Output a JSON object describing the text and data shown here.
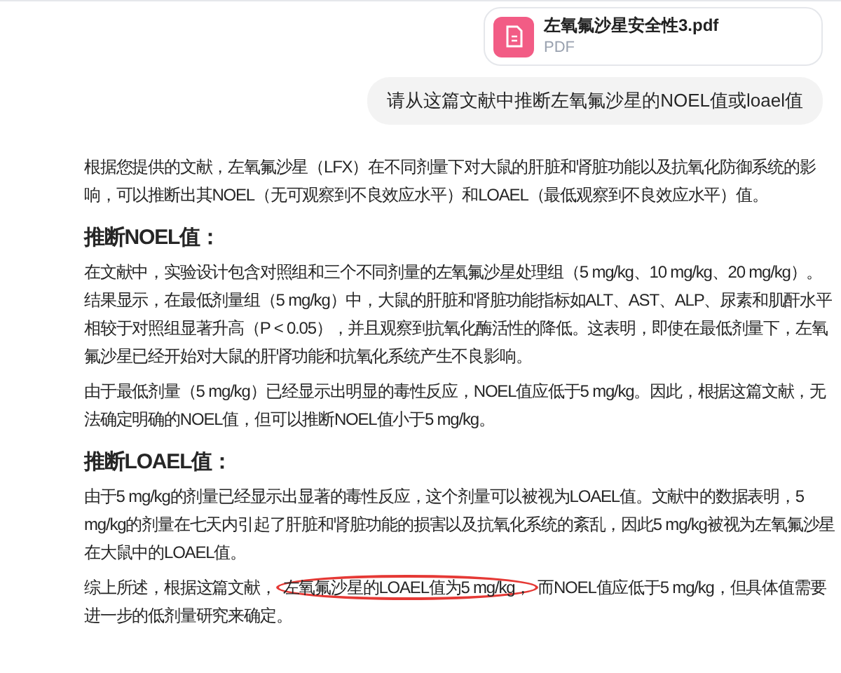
{
  "attachment": {
    "name": "左氧氟沙星安全性3.pdf",
    "type": "PDF"
  },
  "user_message": "请从这篇文献中推断左氧氟沙星的NOEL值或loael值",
  "answer": [
    {
      "kind": "paragraph",
      "parts": [
        {
          "text": "根据您提供的文献，左氧氟沙星（LFX）在不同剂量下对大鼠的肝脏和肾脏功能以及抗氧化防御系统的影响，可以推断出其NOEL（无可观察到不良效应水平）和LOAEL（最低观察到不良效应水平）值。",
          "circled": false
        }
      ]
    },
    {
      "kind": "heading",
      "parts": [
        {
          "text": "推断NOEL值：",
          "circled": false
        }
      ]
    },
    {
      "kind": "paragraph",
      "parts": [
        {
          "text": "在文献中，实验设计包含对照组和三个不同剂量的左氧氟沙星处理组（5 mg/kg、10 mg/kg、20 mg/kg）。结果显示，在最低剂量组（5 mg/kg）中，大鼠的肝脏和肾脏功能指标如ALT、AST、ALP、尿素和肌酐水平相较于对照组显著升高（P < 0.05），并且观察到抗氧化酶活性的降低。这表明，即使在最低剂量下，左氧氟沙星已经开始对大鼠的肝肾功能和抗氧化系统产生不良影响。",
          "circled": false
        }
      ]
    },
    {
      "kind": "paragraph",
      "parts": [
        {
          "text": "由于最低剂量（5 mg/kg）已经显示出明显的毒性反应，NOEL值应低于5 mg/kg。因此，根据这篇文献，无法确定明确的NOEL值，但可以推断NOEL值小于5 mg/kg。",
          "circled": false
        }
      ]
    },
    {
      "kind": "heading",
      "parts": [
        {
          "text": "推断LOAEL值：",
          "circled": false
        }
      ]
    },
    {
      "kind": "paragraph",
      "parts": [
        {
          "text": "由于5 mg/kg的剂量已经显示出显著的毒性反应，这个剂量可以被视为LOAEL值。文献中的数据表明，5 mg/kg的剂量在七天内引起了肝脏和肾脏功能的损害以及抗氧化系统的紊乱，因此5 mg/kg被视为左氧氟沙星在大鼠中的LOAEL值。",
          "circled": false
        }
      ]
    },
    {
      "kind": "paragraph",
      "parts": [
        {
          "text": "综上所述，根据这篇文献，",
          "circled": false
        },
        {
          "text": "左氧氟沙星的LOAEL值为5 mg/kg，",
          "circled": true
        },
        {
          "text": "而NOEL值应低于5 mg/kg，但具体值需要进一步的低剂量研究来确定。",
          "circled": false
        }
      ]
    }
  ]
}
